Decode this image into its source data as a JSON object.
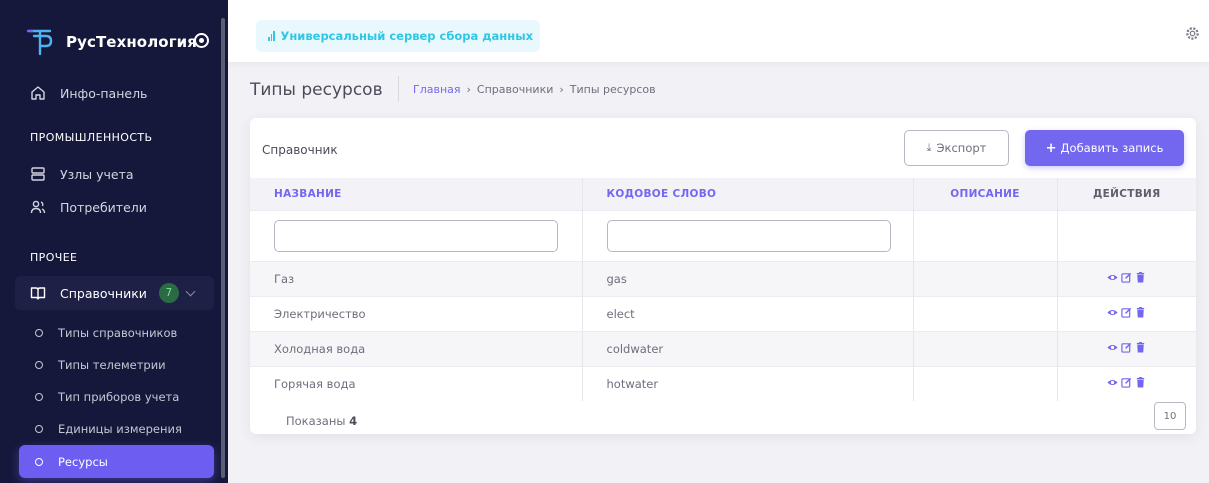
{
  "colors": {
    "sidebar_bg": "#15183a",
    "accent": "#7367f0",
    "active_item": "#6d5df1",
    "chip_text": "#2ec7e6",
    "badge_bg": "#2a6b44"
  },
  "brand": {
    "name": "РусТехнология",
    "logo_icon": "rustech-logo-icon",
    "toggle_icon": "radio-toggle-icon"
  },
  "sidebar": {
    "info_panel": {
      "label": "Инфо-панель",
      "icon": "home-icon"
    },
    "section_industry": "ПРОМЫШЛЕННОСТЬ",
    "nodes": {
      "label": "Узлы учета",
      "icon": "server-icon"
    },
    "consumers": {
      "label": "Потребители",
      "icon": "users-icon"
    },
    "section_other": "ПРОЧЕЕ",
    "directories": {
      "label": "Справочники",
      "count": "7",
      "icon": "book-icon"
    },
    "sub_items": [
      {
        "label": "Типы справочников"
      },
      {
        "label": "Типы телеметрии"
      },
      {
        "label": "Тип приборов учета"
      },
      {
        "label": "Единицы измерения"
      },
      {
        "label": "Ресурсы"
      }
    ]
  },
  "header": {
    "chip_label": "Универсальный сервер сбора данных",
    "settings_icon": "gear-icon"
  },
  "page": {
    "title": "Типы ресурсов",
    "breadcrumb": {
      "home": "Главная",
      "sep": "›",
      "level1": "Справочники",
      "current": "Типы ресурсов"
    }
  },
  "card": {
    "title": "Справочник",
    "export_label": "Экспорт",
    "add_label": "Добавить запись",
    "columns": {
      "name": "НАЗВАНИЕ",
      "code": "КОДОВОЕ СЛОВО",
      "desc": "ОПИСАНИЕ",
      "actions": "ДЕЙСТВИЯ"
    },
    "rows": [
      {
        "name": "Газ",
        "code": "gas",
        "desc": ""
      },
      {
        "name": "Электричество",
        "code": "elect",
        "desc": ""
      },
      {
        "name": "Холодная вода",
        "code": "coldwater",
        "desc": ""
      },
      {
        "name": "Горячая вода",
        "code": "hotwater",
        "desc": ""
      }
    ],
    "footer_label": "Показаны",
    "footer_count": "4",
    "per_page": "10"
  }
}
